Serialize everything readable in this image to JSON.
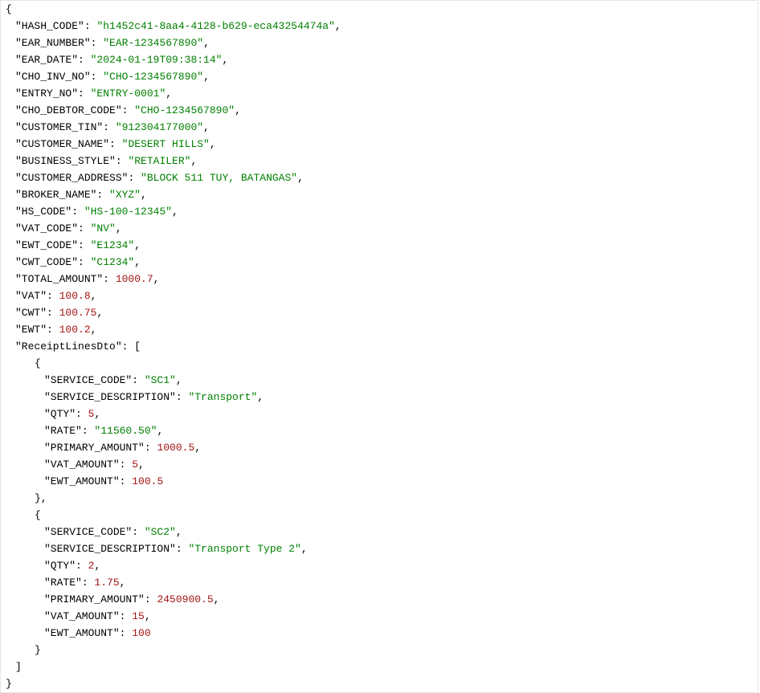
{
  "braces": {
    "open": "{",
    "close": "}",
    "open_bracket": "[",
    "close_bracket": "]"
  },
  "fields": {
    "HASH_CODE": {
      "key": "\"HASH_CODE\"",
      "val": "\"h1452c41-8aa4-4128-b629-eca43254474a\""
    },
    "EAR_NUMBER": {
      "key": "\"EAR_NUMBER\"",
      "val": "\"EAR-1234567890\""
    },
    "EAR_DATE": {
      "key": "\"EAR_DATE\"",
      "val": "\"2024-01-19T09:38:14\""
    },
    "CHO_INV_NO": {
      "key": "\"CHO_INV_NO\"",
      "val": "\"CHO-1234567890\""
    },
    "ENTRY_NO": {
      "key": "\"ENTRY_NO\"",
      "val": "\"ENTRY-0001\""
    },
    "CHO_DEBTOR_CODE": {
      "key": "\"CHO_DEBTOR_CODE\"",
      "val": "\"CHO-1234567890\""
    },
    "CUSTOMER_TIN": {
      "key": "\"CUSTOMER_TIN\"",
      "val": "\"912304177000\""
    },
    "CUSTOMER_NAME": {
      "key": "\"CUSTOMER_NAME\"",
      "val": "\"DESERT HILLS\""
    },
    "BUSINESS_STYLE": {
      "key": "\"BUSINESS_STYLE\"",
      "val": "\"RETAILER\""
    },
    "CUSTOMER_ADDRESS": {
      "key": "\"CUSTOMER_ADDRESS\"",
      "val": "\"BLOCK 511 TUY, BATANGAS\""
    },
    "BROKER_NAME": {
      "key": "\"BROKER_NAME\"",
      "val": "\"XYZ\""
    },
    "HS_CODE": {
      "key": "\"HS_CODE\"",
      "val": "\"HS-100-12345\""
    },
    "VAT_CODE": {
      "key": "\"VAT_CODE\"",
      "val": "\"NV\""
    },
    "EWT_CODE": {
      "key": "\"EWT_CODE\"",
      "val": "\"E1234\""
    },
    "CWT_CODE": {
      "key": "\"CWT_CODE\"",
      "val": "\"C1234\""
    },
    "TOTAL_AMOUNT": {
      "key": "\"TOTAL_AMOUNT\"",
      "val": "1000.7"
    },
    "VAT": {
      "key": "\"VAT\"",
      "val": "100.8"
    },
    "CWT": {
      "key": "\"CWT\"",
      "val": "100.75"
    },
    "EWT": {
      "key": "\"EWT\"",
      "val": "100.2"
    },
    "ReceiptLinesDto": {
      "key": "\"ReceiptLinesDto\""
    }
  },
  "line1": {
    "SERVICE_CODE": {
      "key": "\"SERVICE_CODE\"",
      "val": "\"SC1\""
    },
    "SERVICE_DESCRIPTION": {
      "key": "\"SERVICE_DESCRIPTION\"",
      "val": "\"Transport\""
    },
    "QTY": {
      "key": "\"QTY\"",
      "val": "5"
    },
    "RATE": {
      "key": "\"RATE\"",
      "val": "\"11560.50\""
    },
    "PRIMARY_AMOUNT": {
      "key": "\"PRIMARY_AMOUNT\"",
      "val": "1000.5"
    },
    "VAT_AMOUNT": {
      "key": "\"VAT_AMOUNT\"",
      "val": "5"
    },
    "EWT_AMOUNT": {
      "key": "\"EWT_AMOUNT\"",
      "val": "100.5"
    }
  },
  "line2": {
    "SERVICE_CODE": {
      "key": "\"SERVICE_CODE\"",
      "val": "\"SC2\""
    },
    "SERVICE_DESCRIPTION": {
      "key": "\"SERVICE_DESCRIPTION\"",
      "val": "\"Transport Type 2\""
    },
    "QTY": {
      "key": "\"QTY\"",
      "val": "2"
    },
    "RATE": {
      "key": "\"RATE\"",
      "val": "1.75"
    },
    "PRIMARY_AMOUNT": {
      "key": "\"PRIMARY_AMOUNT\"",
      "val": "2450900.5"
    },
    "VAT_AMOUNT": {
      "key": "\"VAT_AMOUNT\"",
      "val": "15"
    },
    "EWT_AMOUNT": {
      "key": "\"EWT_AMOUNT\"",
      "val": "100"
    }
  }
}
